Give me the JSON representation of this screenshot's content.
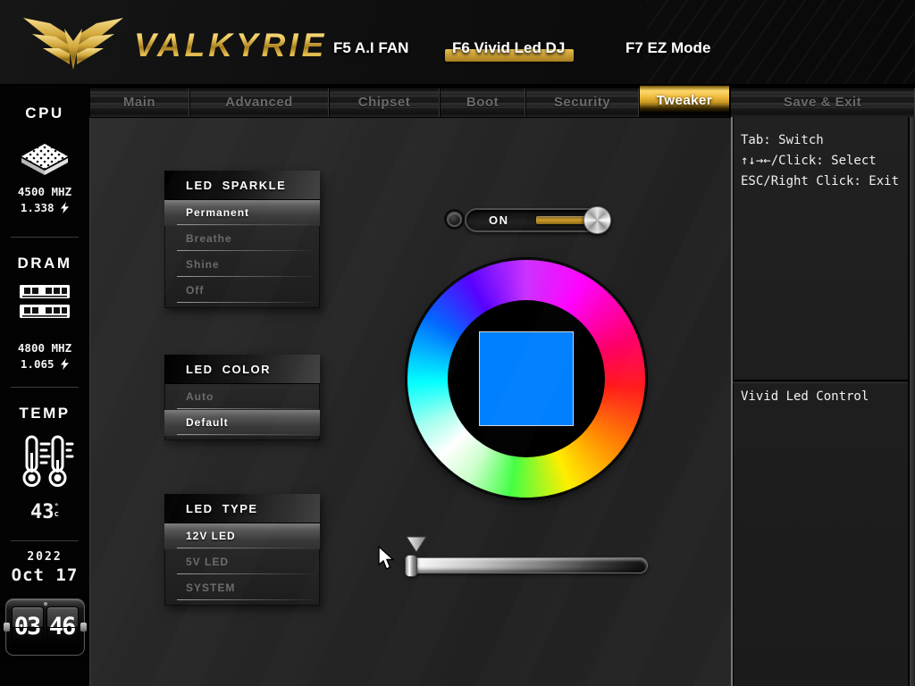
{
  "header": {
    "brand": "VALKYRIE",
    "menu": [
      {
        "label": "F5 A.I FAN",
        "active": false
      },
      {
        "label": "F6 Vivid Led DJ",
        "active": true
      },
      {
        "label": "F7 EZ Mode",
        "active": false
      }
    ]
  },
  "tabs": [
    {
      "label": "Main",
      "active": false
    },
    {
      "label": "Advanced",
      "active": false
    },
    {
      "label": "Chipset",
      "active": false
    },
    {
      "label": "Boot",
      "active": false
    },
    {
      "label": "Security",
      "active": false
    },
    {
      "label": "Tweaker",
      "active": true
    },
    {
      "label": "Save & Exit",
      "active": false
    }
  ],
  "sidebar": {
    "cpu": {
      "title": "CPU",
      "frequency": "4500 MHZ",
      "voltage": "1.338"
    },
    "dram": {
      "title": "DRAM",
      "frequency": "4800 MHZ",
      "voltage": "1.065"
    },
    "temp": {
      "title": "TEMP",
      "value": "43",
      "degree": "°",
      "unit": "c"
    },
    "date": {
      "year": "2022",
      "month_day": "Oct 17"
    },
    "clock": {
      "hours": "03",
      "minutes": "46"
    }
  },
  "led_sparkle": {
    "title": "LED SPARKLE",
    "options": [
      {
        "label": "Permanent",
        "selected": true
      },
      {
        "label": "Breathe",
        "selected": false
      },
      {
        "label": "Shine",
        "selected": false
      },
      {
        "label": "Off",
        "selected": false
      }
    ]
  },
  "led_color": {
    "title": "LED COLOR",
    "options": [
      {
        "label": "Auto",
        "selected": false
      },
      {
        "label": "Default",
        "selected": true
      }
    ]
  },
  "led_type": {
    "title": "LED TYPE",
    "options": [
      {
        "label": "12V LED",
        "selected": true
      },
      {
        "label": "5V LED",
        "selected": false
      },
      {
        "label": "SYSTEM",
        "selected": false
      }
    ]
  },
  "vivid_control": {
    "power_label": "ON",
    "power_state": true,
    "picked_color": "#0080ff"
  },
  "help_panel": {
    "lines": [
      "Tab: Switch",
      "↑↓→←/Click: Select",
      "ESC/Right Click: Exit"
    ],
    "description": "Vivid Led Control"
  },
  "colors": {
    "accent_gold": "#cfa23a"
  }
}
